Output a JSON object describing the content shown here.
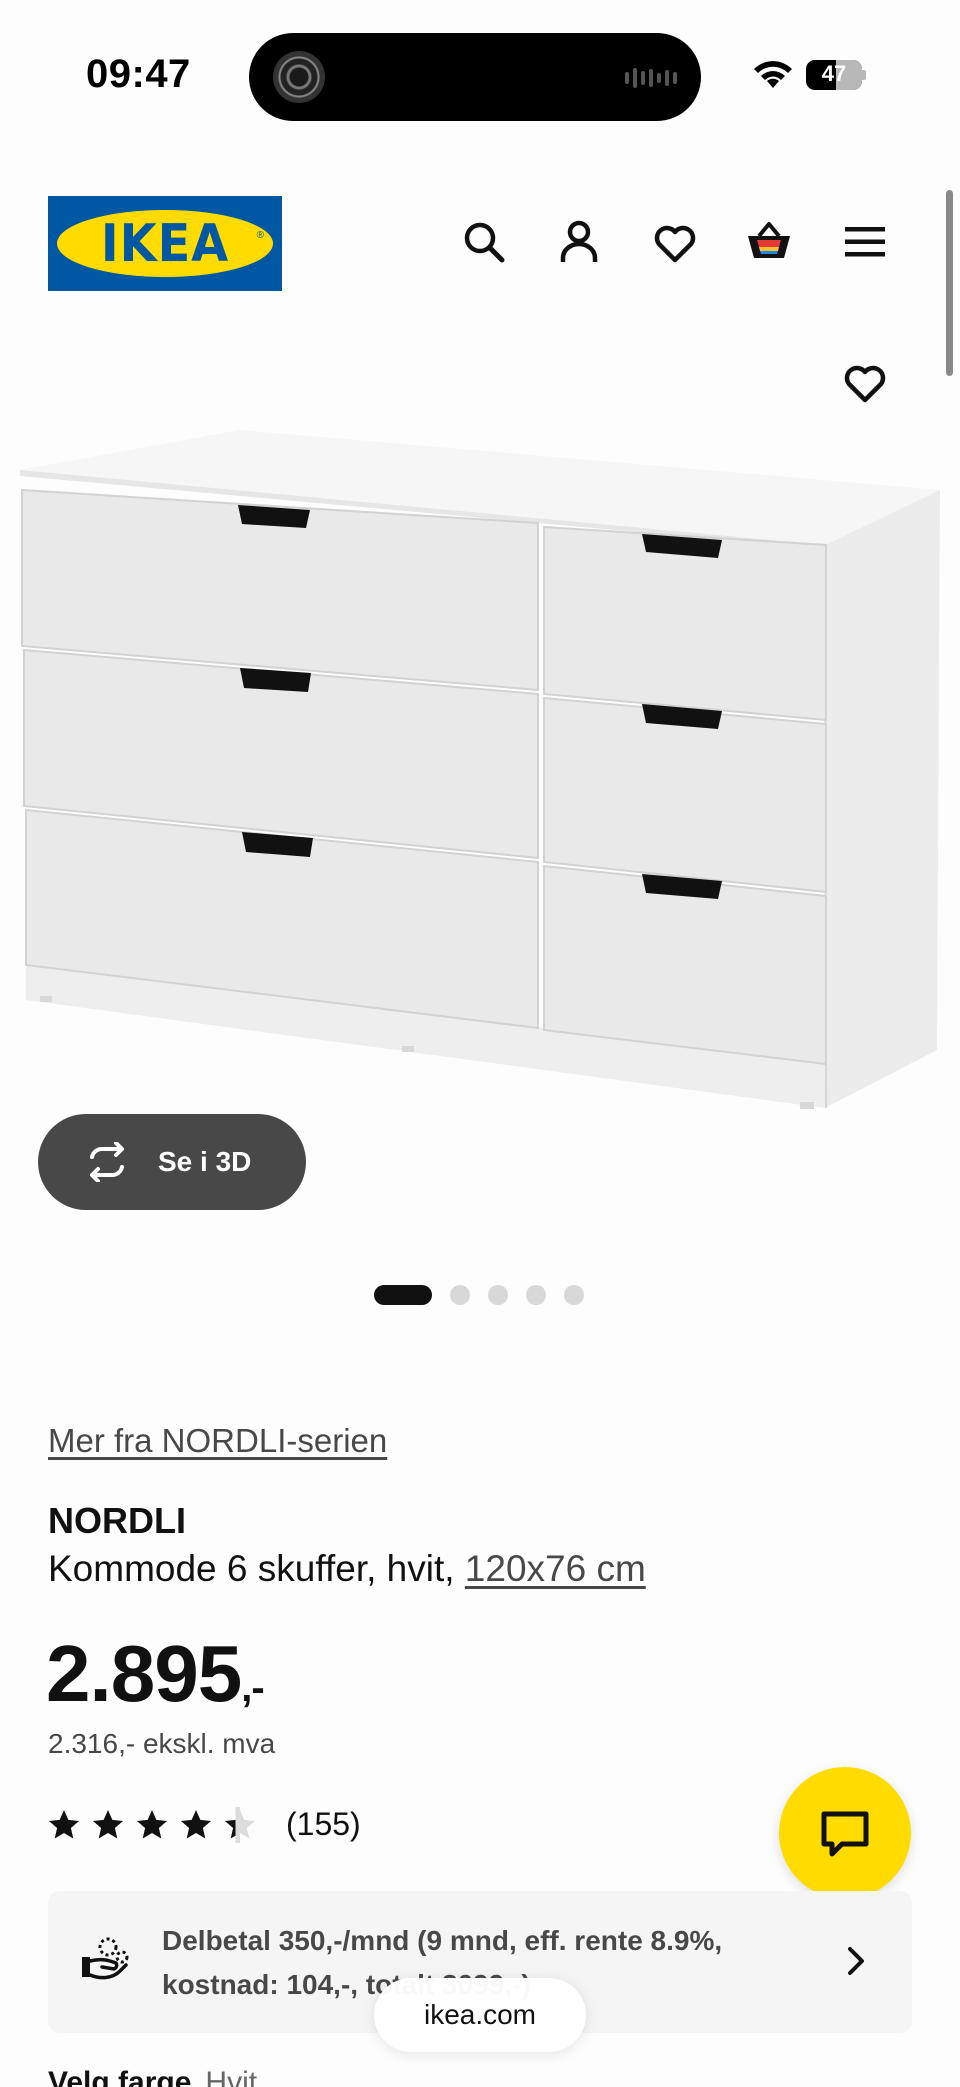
{
  "status_bar": {
    "time": "09:47",
    "battery": "47"
  },
  "header": {
    "logo_text": "IKEA",
    "logo_colors": {
      "blue": "#0058a3",
      "yellow": "#ffdb00"
    },
    "icons": [
      "search-icon",
      "account-icon",
      "wishlist-icon",
      "basket-icon",
      "menu-icon"
    ]
  },
  "gallery": {
    "view_3d_label": "Se i 3D",
    "slide_count": 5,
    "active_slide": 1
  },
  "product": {
    "series_link": "Mer fra NORDLI-serien",
    "name": "NORDLI",
    "description": "Kommode 6 skuffer, hvit, ",
    "size": "120x76 cm",
    "price": "2.895",
    "price_suffix": ",-",
    "price_ex_vat": "2.316,- ekskl. mva",
    "rating": 4.5,
    "review_count": "(155)"
  },
  "finance": {
    "line1": "Delbetal 350,-/mnd (9 mnd, eff. rente 8.9%,",
    "line2": "kostnad: 104,-, totalt 3099,-)"
  },
  "browser": {
    "url": "ikea.com"
  },
  "below_fold": {
    "label": "Velg farge",
    "value": "Hvit"
  }
}
